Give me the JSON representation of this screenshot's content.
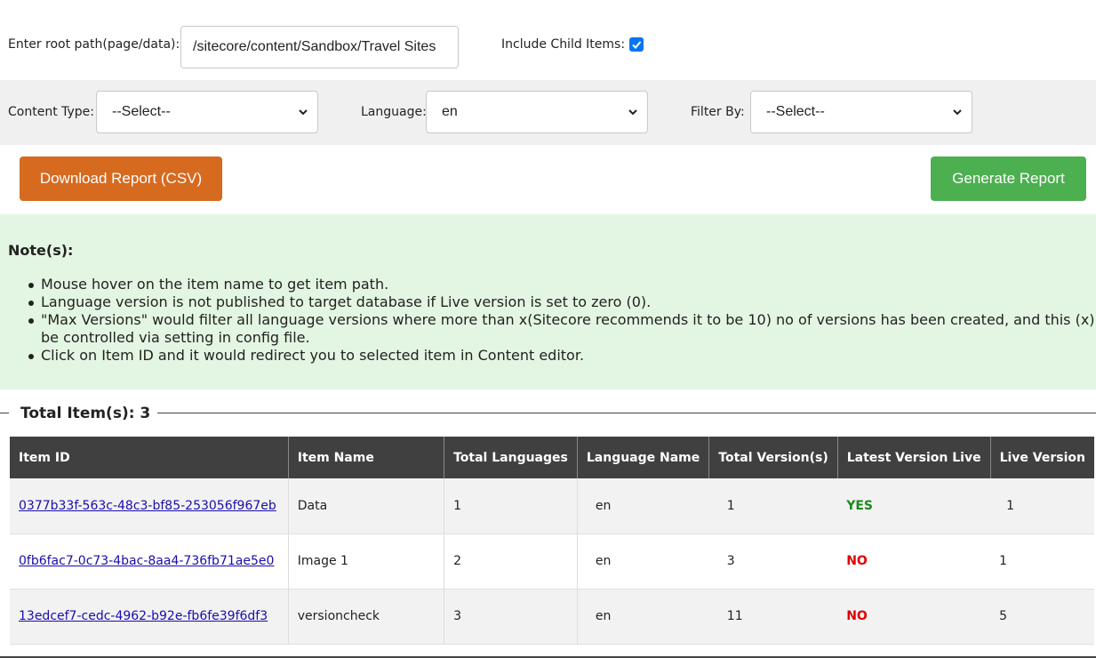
{
  "filters": {
    "root_path_label": "Enter root path(page/data):",
    "root_path_value": "/sitecore/content/Sandbox/Travel Sites",
    "include_child_label": "Include Child Items:",
    "include_child_checked": true,
    "content_type_label": "Content Type:",
    "content_type_value": "--Select--",
    "language_label": "Language:",
    "language_value": "en",
    "filter_by_label": "Filter By:",
    "filter_by_value": "--Select--"
  },
  "actions": {
    "download_label": "Download Report (CSV)",
    "generate_label": "Generate Report"
  },
  "notes": {
    "title": "Note(s):",
    "items": [
      "Mouse hover on the item name to get item path.",
      "Language version is not published to target database if Live version is set to zero (0).",
      "\"Max Versions\" would filter all language versions where more than x(Sitecore recommends it to be 10) no of versions has been created, and this (x) can",
      "Click on Item ID and it would redirect you to selected item in Content editor."
    ],
    "item3_continuation": "be controlled via setting in config file."
  },
  "total_label": "Total Item(s): 3",
  "table": {
    "headers": [
      "Item ID",
      "Item Name",
      "Total Languages",
      "Language Name",
      "Total Version(s)",
      "Latest Version Live",
      "Live Version"
    ],
    "rows": [
      {
        "id": "0377b33f-563c-48c3-bf85-253056f967eb",
        "name": "Data",
        "total_languages": "1",
        "language": "en",
        "total_versions": "1",
        "latest_live": "YES",
        "live_version": "1"
      },
      {
        "id": "0fb6fac7-0c73-4bac-8aa4-736fb71ae5e0",
        "name": "Image 1",
        "total_languages": "2",
        "language": "en",
        "total_versions": "3",
        "latest_live": "NO",
        "live_version": "1"
      },
      {
        "id": "13edcef7-cedc-4962-b92e-fb6fe39f6df3",
        "name": "versioncheck",
        "total_languages": "3",
        "language": "en",
        "total_versions": "11",
        "latest_live": "NO",
        "live_version": "5"
      }
    ]
  },
  "colors": {
    "download_button": "#d66a1f",
    "generate_button": "#4caf50",
    "notes_bg": "#e3f6e3",
    "table_header_bg": "#404040",
    "yes": "#1a8a1a",
    "no": "#e00000",
    "checkbox": "#0b75f0"
  }
}
